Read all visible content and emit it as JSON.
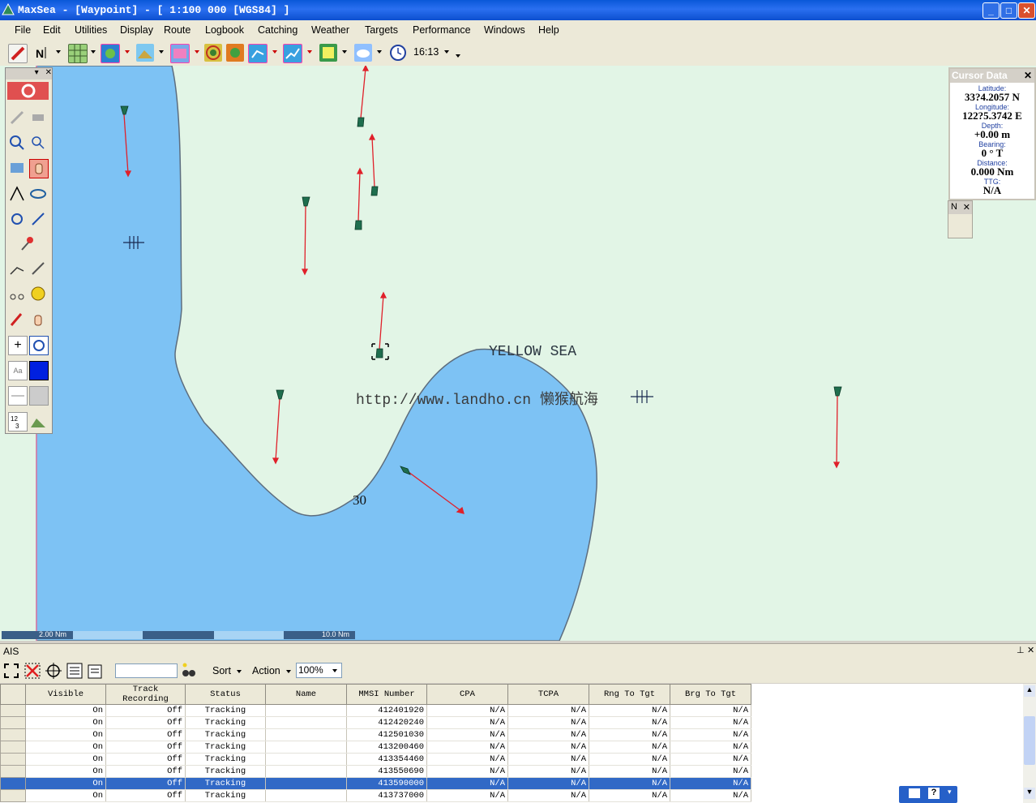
{
  "window": {
    "title": "MaxSea - [Waypoint] - [ 1:100 000 [WGS84] ]",
    "buttons": {
      "minimize": "_",
      "maximize": "□",
      "close": "✕"
    }
  },
  "menu": [
    "File",
    "Edit",
    "Utilities",
    "Display",
    "Route",
    "Logbook",
    "Catching",
    "Weather",
    "Targets",
    "Performance",
    "Windows",
    "Help"
  ],
  "toolbar": {
    "clock_time": "16:13"
  },
  "map": {
    "sea_label": "YELLOW SEA",
    "watermark": "http://www.landho.cn 懒猴航海",
    "depth_label": "30",
    "colors": {
      "land": "#e2f5e6",
      "deep_water": "#7dc2f4",
      "coast": "#5d6d7e",
      "vector": "#e0202a",
      "target": "#1f6e4e"
    },
    "scale": {
      "left_label": "2.00 Nm",
      "right_label": "10.0 Nm"
    }
  },
  "cursor_data": {
    "title": "Cursor Data",
    "latitude_label": "Latitude:",
    "latitude": "33?4.2057 N",
    "longitude_label": "Longitude:",
    "longitude": "122?5.3742 E",
    "depth_label": "Depth:",
    "depth": "+0.00 m",
    "bearing_label": "Bearing:",
    "bearing": "0 ° T",
    "distance_label": "Distance:",
    "distance": "0.000 Nm",
    "ttg_label": "TTG:",
    "ttg": "N/A"
  },
  "north_panel": {
    "label": "N"
  },
  "ais": {
    "title": "AIS",
    "sort_label": "Sort",
    "action_label": "Action",
    "zoom": "100%",
    "search_value": "",
    "columns": [
      "Visible",
      "Track Recording",
      "Status",
      "Name",
      "MMSI Number",
      "CPA",
      "TCPA",
      "Rng To Tgt",
      "Brg To Tgt"
    ],
    "rows": [
      [
        "On",
        "Off",
        "Tracking",
        "",
        "412401920",
        "N/A",
        "N/A",
        "N/A",
        "N/A"
      ],
      [
        "On",
        "Off",
        "Tracking",
        "",
        "412420240",
        "N/A",
        "N/A",
        "N/A",
        "N/A"
      ],
      [
        "On",
        "Off",
        "Tracking",
        "",
        "412501030",
        "N/A",
        "N/A",
        "N/A",
        "N/A"
      ],
      [
        "On",
        "Off",
        "Tracking",
        "",
        "413200460",
        "N/A",
        "N/A",
        "N/A",
        "N/A"
      ],
      [
        "On",
        "Off",
        "Tracking",
        "",
        "413354460",
        "N/A",
        "N/A",
        "N/A",
        "N/A"
      ],
      [
        "On",
        "Off",
        "Tracking",
        "",
        "413550690",
        "N/A",
        "N/A",
        "N/A",
        "N/A"
      ],
      [
        "On",
        "Off",
        "Tracking",
        "",
        "413590000",
        "N/A",
        "N/A",
        "N/A",
        "N/A"
      ],
      [
        "On",
        "Off",
        "Tracking",
        "",
        "413737000",
        "N/A",
        "N/A",
        "N/A",
        "N/A"
      ]
    ],
    "selected_row": 6
  }
}
